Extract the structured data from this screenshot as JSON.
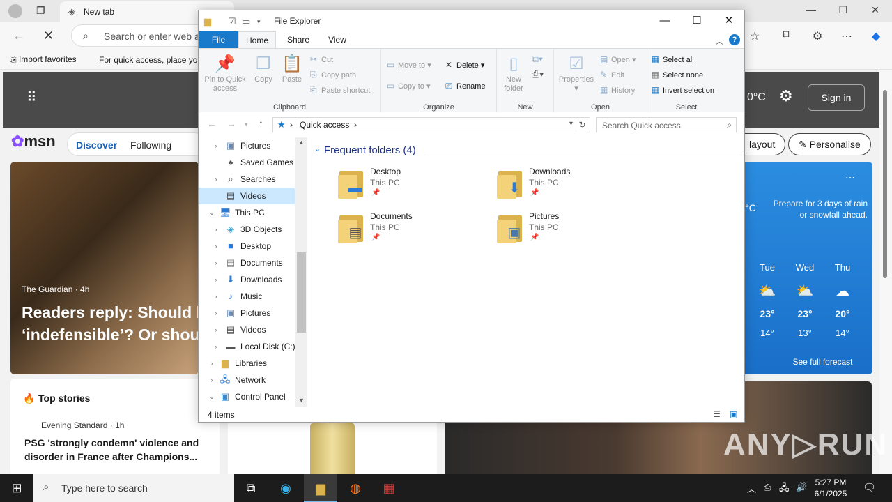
{
  "edge": {
    "tab_label": "New tab",
    "address_placeholder": "Search or enter web a",
    "fav_import": "Import favorites",
    "fav_hint": "For quick access, place you",
    "signin": "Sign in",
    "temp_fragment": "0°C",
    "discover": "Discover",
    "following": "Following",
    "layout_pill": "layout",
    "personalise_pill": "Personalise",
    "hero_source": "The Guardian · 4h",
    "hero_headline_1": "Readers reply: Should b",
    "hero_headline_2": "‘indefensible’? Or shoul",
    "weather_alert": "Prepare for 3 days of rain or snowfall ahead.",
    "weather_c": "°C",
    "weather_days": [
      {
        "day": "Tue",
        "hi": "23°",
        "lo": "14°",
        "icon": "partly-sunny-icon"
      },
      {
        "day": "Wed",
        "hi": "23°",
        "lo": "13°",
        "icon": "partly-sunny-icon"
      },
      {
        "day": "Thu",
        "hi": "20°",
        "lo": "14°",
        "icon": "cloudy-icon"
      }
    ],
    "forecast_link": "See full forecast",
    "top_stories": "Top stories",
    "story_source": "Evening Standard · 1h",
    "story_headline": "PSG 'strongly condemn' violence and disorder in France after Champions..."
  },
  "explorer": {
    "title": "File Explorer",
    "tabs": [
      "File",
      "Home",
      "Share",
      "View"
    ],
    "clipboard": {
      "label": "Clipboard",
      "pin": "Pin to Quick access",
      "copy": "Copy",
      "paste": "Paste",
      "cut": "Cut",
      "copy_path": "Copy path",
      "paste_shortcut": "Paste shortcut"
    },
    "organize": {
      "label": "Organize",
      "move_to": "Move to",
      "copy_to": "Copy to",
      "delete": "Delete",
      "rename": "Rename"
    },
    "new": {
      "label": "New",
      "new_folder": "New folder"
    },
    "open": {
      "label": "Open",
      "properties": "Properties",
      "open": "Open",
      "edit": "Edit",
      "history": "History"
    },
    "select": {
      "label": "Select",
      "select_all": "Select all",
      "select_none": "Select none",
      "invert": "Invert selection"
    },
    "address": {
      "segment": "Quick access",
      "search_placeholder": "Search Quick access"
    },
    "nav_items": [
      {
        "label": "Pictures",
        "indent": 1,
        "expand": ">"
      },
      {
        "label": "Saved Games",
        "indent": 1,
        "expand": ""
      },
      {
        "label": "Searches",
        "indent": 1,
        "expand": ">"
      },
      {
        "label": "Videos",
        "indent": 1,
        "expand": ""
      },
      {
        "label": "This PC",
        "indent": 0,
        "expand": "v"
      },
      {
        "label": "3D Objects",
        "indent": 1,
        "expand": ">"
      },
      {
        "label": "Desktop",
        "indent": 1,
        "expand": ">"
      },
      {
        "label": "Documents",
        "indent": 1,
        "expand": ">"
      },
      {
        "label": "Downloads",
        "indent": 1,
        "expand": ">"
      },
      {
        "label": "Music",
        "indent": 1,
        "expand": ">"
      },
      {
        "label": "Pictures",
        "indent": 1,
        "expand": ">"
      },
      {
        "label": "Videos",
        "indent": 1,
        "expand": ">"
      },
      {
        "label": "Local Disk (C:)",
        "indent": 1,
        "expand": ">"
      },
      {
        "label": "Libraries",
        "indent": 0,
        "expand": ">"
      },
      {
        "label": "Network",
        "indent": 0,
        "expand": ">"
      },
      {
        "label": "Control Panel",
        "indent": 0,
        "expand": "v"
      }
    ],
    "group_title": "Frequent folders (4)",
    "folders": [
      {
        "name": "Desktop",
        "location": "This PC"
      },
      {
        "name": "Downloads",
        "location": "This PC"
      },
      {
        "name": "Documents",
        "location": "This PC"
      },
      {
        "name": "Pictures",
        "location": "This PC"
      }
    ],
    "status": "4 items"
  },
  "taskbar": {
    "search_placeholder": "Type here to search",
    "time": "5:27 PM",
    "date": "6/1/2025"
  }
}
